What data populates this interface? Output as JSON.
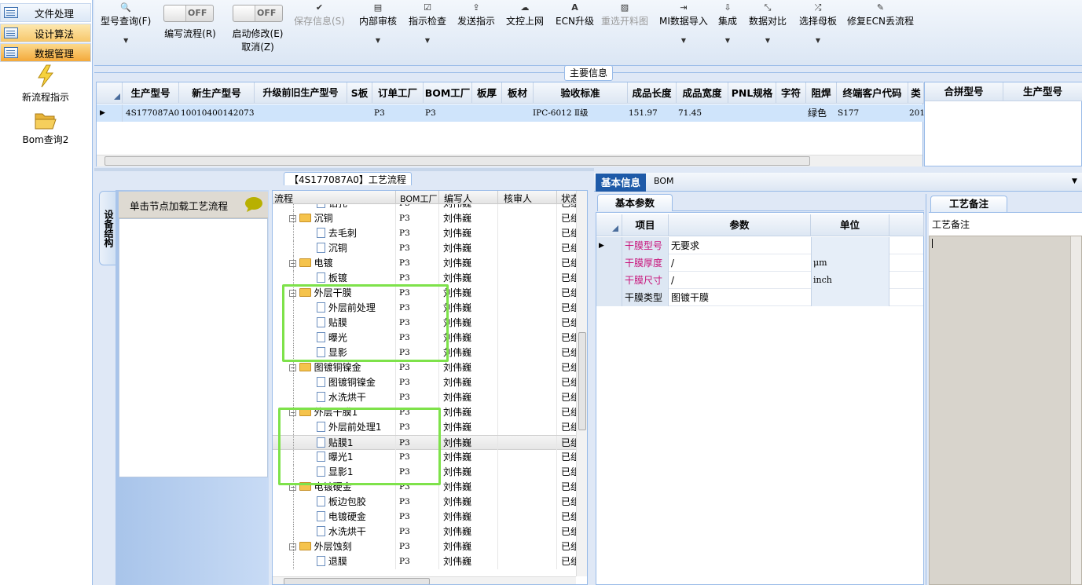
{
  "nav": {
    "items": [
      {
        "label": "文件处理"
      },
      {
        "label": "设计算法"
      },
      {
        "label": "数据管理"
      }
    ],
    "shortcuts": [
      {
        "label": "新流程指示",
        "icon": "lightning-icon"
      },
      {
        "label": "Bom查询2",
        "icon": "folder-open-icon"
      }
    ]
  },
  "toolbar": {
    "model_query": "型号查询(F)",
    "write_flow": "编写流程(R)",
    "start_modify": "启动修改(E)",
    "cancel": "取消(Z)",
    "toggle_off": "OFF",
    "save_info": "保存信息(S)",
    "internal_review": "内部审核",
    "instruction_check": "指示检查",
    "send_instruction": "发送指示",
    "upload_docs": "文控上网",
    "ecn_upgrade": "ECN升级",
    "reselect_chart": "重选开料图",
    "mi_import": "MI数据导入",
    "integrate": "集成",
    "data_compare": "数据对比",
    "select_master": "选择母板",
    "repair_ecn": "修复ECN丢流程"
  },
  "main_info": {
    "title": "主要信息",
    "columns": [
      "生产型号",
      "新生产型号",
      "升级前旧生产型号",
      "S板",
      "订单工厂",
      "BOM工厂",
      "板厚",
      "板材",
      "验收标准",
      "成品长度",
      "成品宽度",
      "PNL规格",
      "字符",
      "阻焊",
      "终端客户代码",
      "类"
    ],
    "row": {
      "prod_model": "4S177087A0",
      "new_model": "10010400142073",
      "old_model": "",
      "s_board": "",
      "order_factory": "P3",
      "bom_factory": "P3",
      "thickness": "",
      "material": "",
      "standard": "IPC-6012 Ⅱ级",
      "length": "151.97",
      "width": "71.45",
      "pnl": "",
      "char": "",
      "solder": "绿色",
      "customer": "S177",
      "extra": "201"
    },
    "side_columns": [
      "合拼型号",
      "生产型号"
    ]
  },
  "process": {
    "title": "【4S177087A0】工艺流程",
    "side_tab": "设备结构",
    "hint": "单击节点加载工艺流程",
    "columns": [
      "流程",
      "BOM工厂",
      "编写人",
      "核审人",
      "状态"
    ],
    "rows": [
      {
        "name": "钻孔",
        "type": "file",
        "level": 2,
        "factory": "P3",
        "author": "刘伟巍",
        "status": "已组"
      },
      {
        "name": "沉铜",
        "type": "folder",
        "level": 1,
        "factory": "P3",
        "author": "刘伟巍",
        "status": "已组"
      },
      {
        "name": "去毛刺",
        "type": "file",
        "level": 2,
        "factory": "P3",
        "author": "刘伟巍",
        "status": "已组"
      },
      {
        "name": "沉铜",
        "type": "file",
        "level": 2,
        "factory": "P3",
        "author": "刘伟巍",
        "status": "已组"
      },
      {
        "name": "电镀",
        "type": "folder",
        "level": 1,
        "factory": "P3",
        "author": "刘伟巍",
        "status": "已组"
      },
      {
        "name": "板镀",
        "type": "file",
        "level": 2,
        "factory": "P3",
        "author": "刘伟巍",
        "status": "已组"
      },
      {
        "name": "外层干膜",
        "type": "folder",
        "level": 1,
        "factory": "P3",
        "author": "刘伟巍",
        "status": "已组"
      },
      {
        "name": "外层前处理",
        "type": "file",
        "level": 2,
        "factory": "P3",
        "author": "刘伟巍",
        "status": "已组"
      },
      {
        "name": "贴膜",
        "type": "file",
        "level": 2,
        "factory": "P3",
        "author": "刘伟巍",
        "status": "已组"
      },
      {
        "name": "曝光",
        "type": "file",
        "level": 2,
        "factory": "P3",
        "author": "刘伟巍",
        "status": "已组"
      },
      {
        "name": "显影",
        "type": "file",
        "level": 2,
        "factory": "P3",
        "author": "刘伟巍",
        "status": "已组"
      },
      {
        "name": "图镀铜镍金",
        "type": "folder",
        "level": 1,
        "factory": "P3",
        "author": "刘伟巍",
        "status": "已组"
      },
      {
        "name": "图镀铜镍金",
        "type": "file",
        "level": 2,
        "factory": "P3",
        "author": "刘伟巍",
        "status": "已组"
      },
      {
        "name": "水洗烘干",
        "type": "file",
        "level": 2,
        "factory": "P3",
        "author": "刘伟巍",
        "status": "已组"
      },
      {
        "name": "外层干膜1",
        "type": "folder",
        "level": 1,
        "factory": "P3",
        "author": "刘伟巍",
        "status": "已组"
      },
      {
        "name": "外层前处理1",
        "type": "file",
        "level": 2,
        "factory": "P3",
        "author": "刘伟巍",
        "status": "已组"
      },
      {
        "name": "贴膜1",
        "type": "file",
        "level": 2,
        "factory": "P3",
        "author": "刘伟巍",
        "status": "已组",
        "selected": true
      },
      {
        "name": "曝光1",
        "type": "file",
        "level": 2,
        "factory": "P3",
        "author": "刘伟巍",
        "status": "已组"
      },
      {
        "name": "显影1",
        "type": "file",
        "level": 2,
        "factory": "P3",
        "author": "刘伟巍",
        "status": "已组"
      },
      {
        "name": "电镀硬金",
        "type": "folder",
        "level": 1,
        "factory": "P3",
        "author": "刘伟巍",
        "status": "已组"
      },
      {
        "name": "板边包胶",
        "type": "file",
        "level": 2,
        "factory": "P3",
        "author": "刘伟巍",
        "status": "已组"
      },
      {
        "name": "电镀硬金",
        "type": "file",
        "level": 2,
        "factory": "P3",
        "author": "刘伟巍",
        "status": "已组"
      },
      {
        "name": "水洗烘干",
        "type": "file",
        "level": 2,
        "factory": "P3",
        "author": "刘伟巍",
        "status": "已组"
      },
      {
        "name": "外层蚀刻",
        "type": "folder",
        "level": 1,
        "factory": "P3",
        "author": "刘伟巍",
        "status": "已组"
      },
      {
        "name": "退膜",
        "type": "file",
        "level": 2,
        "factory": "P3",
        "author": "刘伟巍",
        "status": "已组"
      }
    ]
  },
  "detail": {
    "tabs": [
      "基本信息",
      "BOM"
    ],
    "sub_tab": "基本参数",
    "columns": [
      "项目",
      "参数",
      "单位"
    ],
    "rows": [
      {
        "item": "干膜型号",
        "value": "无要求",
        "unit": "",
        "pink": true
      },
      {
        "item": "干膜厚度",
        "value": "/",
        "unit": "μm",
        "pink": true
      },
      {
        "item": "干膜尺寸",
        "value": "/",
        "unit": "inch",
        "pink": true
      },
      {
        "item": "干膜类型",
        "value": "图镀干膜",
        "unit": "",
        "pink": false
      }
    ],
    "notes_tab": "工艺备注",
    "notes_label": "工艺备注"
  }
}
